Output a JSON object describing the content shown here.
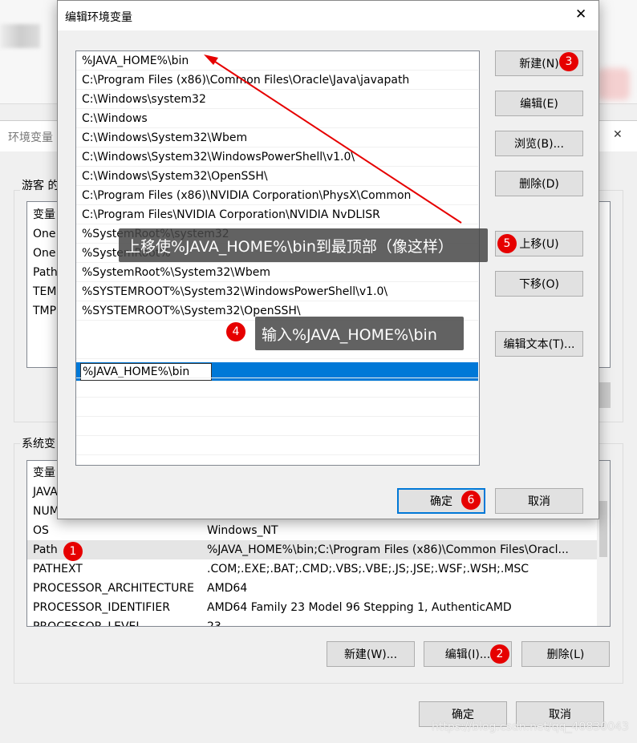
{
  "env_window": {
    "title": "环境变量",
    "close_glyph": "✕",
    "user_group_label": "游客 的",
    "user_vars": {
      "header": "变量",
      "rows": [
        "One",
        "One",
        "Path",
        "TEM",
        "TMP"
      ]
    },
    "system_group_label": "系统变",
    "system_vars": {
      "header": "变量",
      "rows": [
        {
          "name": "JAVA",
          "value": ""
        },
        {
          "name": "NUM",
          "value": ""
        },
        {
          "name": "OS",
          "value": "Windows_NT"
        },
        {
          "name": "Path",
          "value": "%JAVA_HOME%\\bin;C:\\Program Files (x86)\\Common Files\\Oracl...",
          "selected": true
        },
        {
          "name": "PATHEXT",
          "value": ".COM;.EXE;.BAT;.CMD;.VBS;.VBE;.JS;.JSE;.WSF;.WSH;.MSC"
        },
        {
          "name": "PROCESSOR_ARCHITECTURE",
          "value": "AMD64"
        },
        {
          "name": "PROCESSOR_IDENTIFIER",
          "value": "AMD64 Family 23 Model 96 Stepping 1, AuthenticAMD"
        },
        {
          "name": "PROCESSOR_LEVEL",
          "value": "23"
        }
      ]
    },
    "buttons": {
      "new": "新建(W)...",
      "edit": "编辑(I)...",
      "delete": "删除(L)",
      "ok": "确定",
      "cancel": "取消"
    }
  },
  "edit_dialog": {
    "title": "编辑环境变量",
    "close_glyph": "✕",
    "paths": [
      "%JAVA_HOME%\\bin",
      "C:\\Program Files (x86)\\Common Files\\Oracle\\Java\\javapath",
      "C:\\Windows\\system32",
      "C:\\Windows",
      "C:\\Windows\\System32\\Wbem",
      "C:\\Windows\\System32\\WindowsPowerShell\\v1.0\\",
      "C:\\Windows\\System32\\OpenSSH\\",
      "C:\\Program Files (x86)\\NVIDIA Corporation\\PhysX\\Common",
      "C:\\Program Files\\NVIDIA Corporation\\NVIDIA NvDLISR",
      "%SystemRoot%\\system32",
      "%SystemRoot%",
      "%SystemRoot%\\System32\\Wbem",
      "%SYSTEMROOT%\\System32\\WindowsPowerShell\\v1.0\\",
      "%SYSTEMROOT%\\System32\\OpenSSH\\"
    ],
    "editing_value": "%JAVA_HOME%\\bin",
    "buttons": {
      "new": "新建(N)",
      "edit": "编辑(E)",
      "browse": "浏览(B)...",
      "delete": "删除(D)",
      "move_up": "上移(U)",
      "move_down": "下移(O)",
      "edit_text": "编辑文本(T)...",
      "ok": "确定",
      "cancel": "取消"
    }
  },
  "annotations": {
    "badges": [
      "1",
      "2",
      "3",
      "4",
      "5",
      "6"
    ],
    "tip_move_up": "上移使%JAVA_HOME%\\bin到最顶部（像这样）",
    "tip_input": "输入%JAVA_HOME%\\bin",
    "accent": "#e60000"
  },
  "watermark": "https://blog.csdn.net/qq_40830043"
}
